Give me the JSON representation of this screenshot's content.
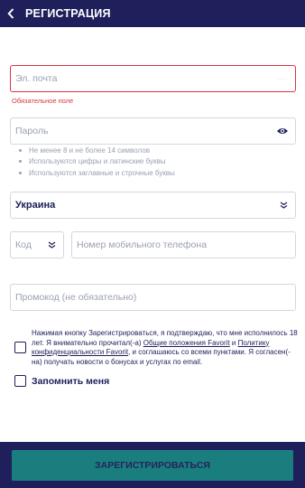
{
  "header": {
    "title": "РЕГИСТРАЦИЯ",
    "back_icon": "chevron-left-icon"
  },
  "email": {
    "placeholder": "Эл. почта",
    "error": "Обязательное поле"
  },
  "password": {
    "placeholder": "Пароль",
    "hints": [
      "Не менее 8 и не более 14 символов",
      "Используются цифры и латинские буквы",
      "Используются заглавные и строчные буквы"
    ]
  },
  "country": {
    "selected": "Украина"
  },
  "phone": {
    "code_placeholder": "Код",
    "number_placeholder": "Номер мобильного телефона"
  },
  "promo": {
    "placeholder": "Промокод (не обязательно)"
  },
  "terms": {
    "text1": "Нажимая кнопку Зарегистрироваться, я подтверждаю, что мне исполнилось 18 лет. Я внимательно прочитал(-а) ",
    "link1": "Общие положения Favorit",
    "and": " и ",
    "link2": "Политику конфиденциальности Favorit",
    "text2": ", и соглашаюсь со всеми пунктами. Я согласен(-на) получать новости о бонусах и услугах по email."
  },
  "remember": {
    "label": "Запомнить меня"
  },
  "submit": {
    "label": "ЗАРЕГИСТРИРОВАТЬСЯ"
  },
  "colors": {
    "header": "#1f1f5c",
    "error": "#d9363e",
    "button": "#1a7e7f"
  }
}
